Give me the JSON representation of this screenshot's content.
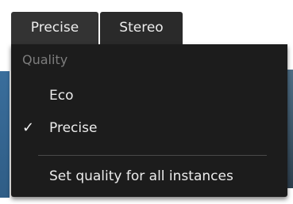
{
  "toolbar": {
    "quality_button_label": "Precise",
    "stereo_button_label": "Stereo"
  },
  "menu": {
    "header": "Quality",
    "items": [
      {
        "label": "Eco",
        "checked": false
      },
      {
        "label": "Precise",
        "checked": true
      },
      {
        "label": "Set quality for all instances",
        "checked": false
      }
    ],
    "check_glyph": "✓"
  },
  "colors": {
    "menu_bg": "#1c1c1c",
    "button_bg": "#2a2a2a",
    "text": "#ececec",
    "header_text": "#7d7d7d",
    "separator": "#4a4a4a"
  }
}
